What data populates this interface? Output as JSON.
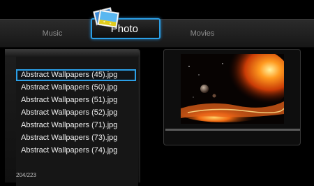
{
  "nav": {
    "items": [
      {
        "label": "Music"
      },
      {
        "label": "Photo"
      },
      {
        "label": "Movies"
      }
    ],
    "selected": "Photo"
  },
  "file_list": {
    "items": [
      "Abstract Wallpapers (45).jpg",
      "Abstract Wallpapers (50).jpg",
      "Abstract Wallpapers (51).jpg",
      "Abstract Wallpapers (52).jpg",
      "Abstract Wallpapers (71).jpg",
      "Abstract Wallpapers (73).jpg",
      "Abstract Wallpapers (74).jpg"
    ],
    "selected_index": 0,
    "counter": "204/223"
  },
  "icons": {
    "photo_category": "photo-stack-icon",
    "preview": "abstract-wallpaper-thumbnail"
  },
  "colors": {
    "accent": "#2b9fe6",
    "background": "#000000",
    "text": "#f0f0f0"
  }
}
